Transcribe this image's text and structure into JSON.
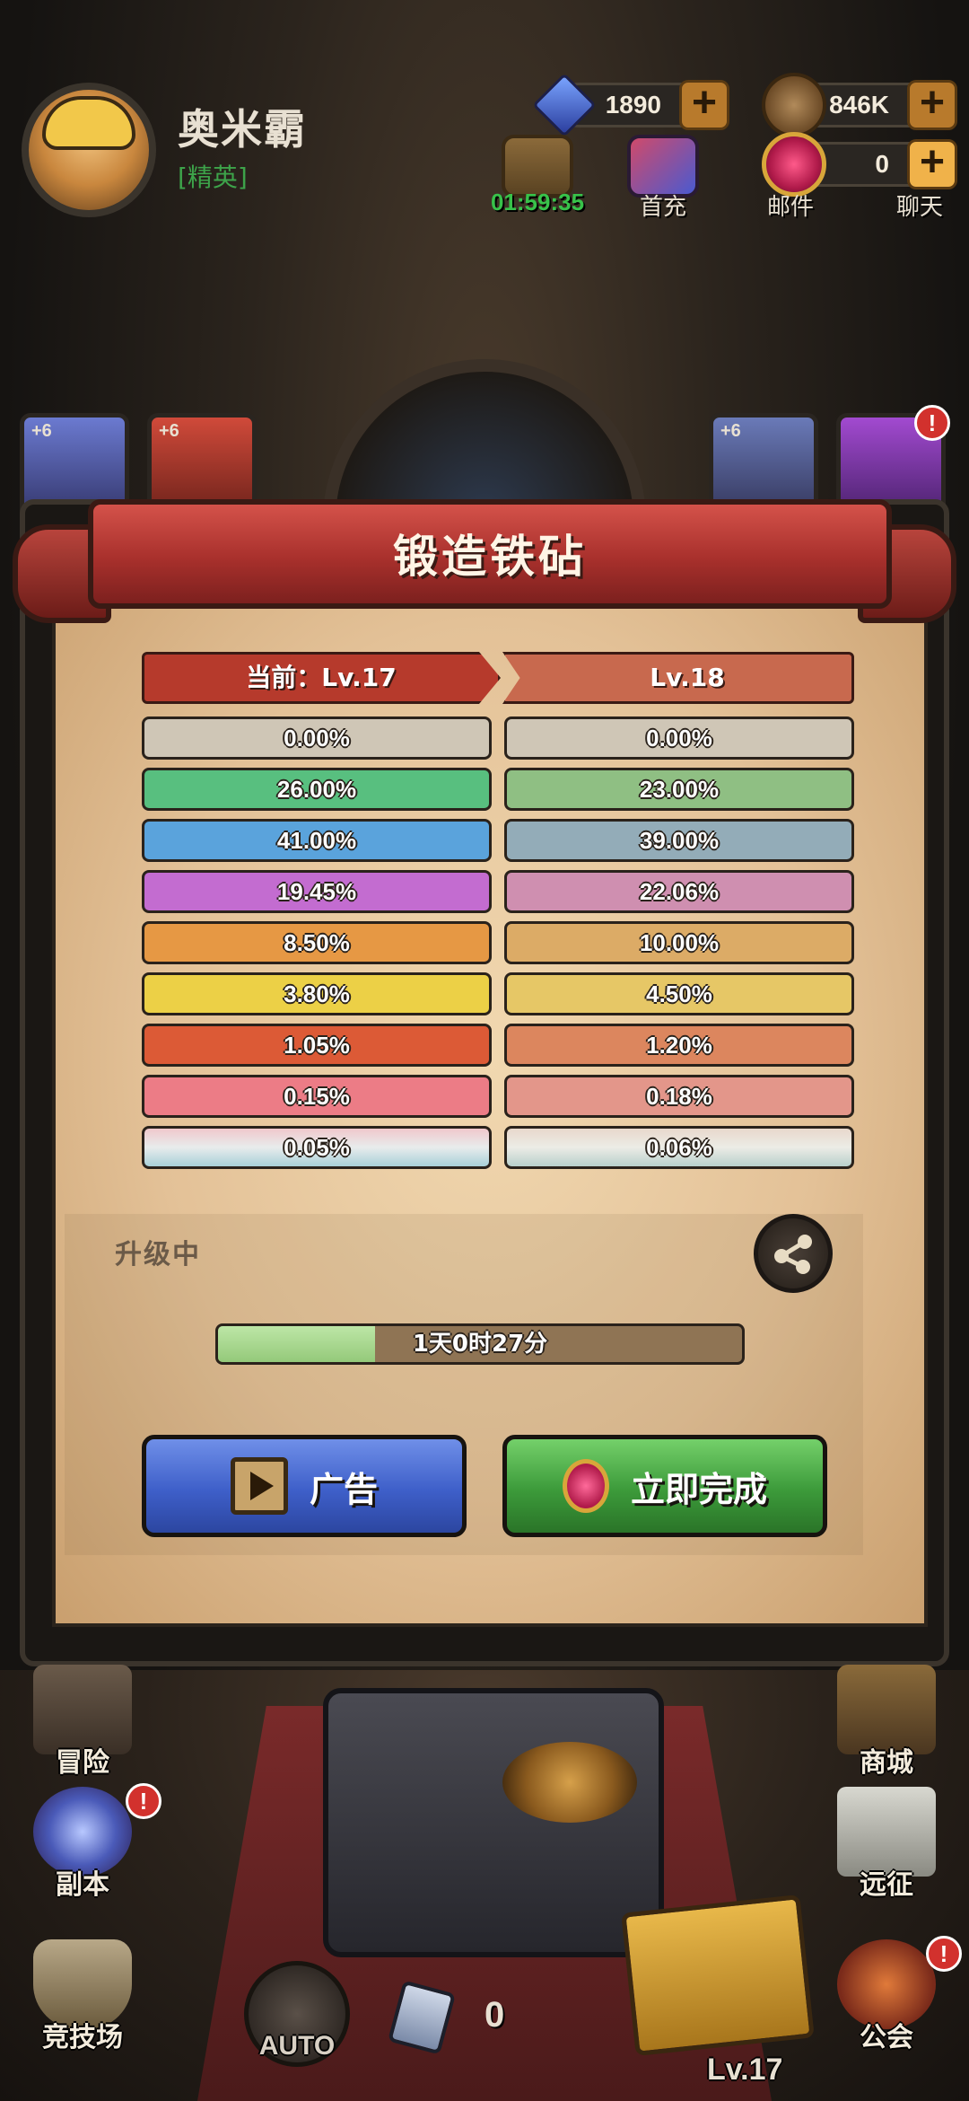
{
  "hud": {
    "player_name": "奥米霸",
    "player_rank": "[精英]",
    "gems": "1890",
    "coins": "846K",
    "pendants": "0",
    "chest_timer": "01:59:35",
    "first_recharge_label": "首充",
    "mail_label": "邮件",
    "chat_label": "聊天"
  },
  "cards": {
    "card1_plus": "+6",
    "card2_plus": "+6",
    "card3_plus": "+6",
    "badge": "!"
  },
  "dialog": {
    "title": "锻造铁砧",
    "current_level": "当前：Lv.17",
    "next_level": "Lv.18",
    "rates": [
      {
        "current": "0.00%",
        "next": "0.00%",
        "color": "#cfc6b6",
        "next_color": "#cfc6b6"
      },
      {
        "current": "26.00%",
        "next": "23.00%",
        "color": "#58bf7f",
        "next_color": "#8fbf83"
      },
      {
        "current": "41.00%",
        "next": "39.00%",
        "color": "#5aa3dc",
        "next_color": "#93acb8"
      },
      {
        "current": "19.45%",
        "next": "22.06%",
        "color": "#c36cd0",
        "next_color": "#cf8fb0"
      },
      {
        "current": "8.50%",
        "next": "10.00%",
        "color": "#e69844",
        "next_color": "#dcab66"
      },
      {
        "current": "3.80%",
        "next": "4.50%",
        "color": "#ecd046",
        "next_color": "#e6c766"
      },
      {
        "current": "1.05%",
        "next": "1.20%",
        "color": "#dc5a36",
        "next_color": "#dc865e"
      },
      {
        "current": "0.15%",
        "next": "0.18%",
        "color": "#ec7c86",
        "next_color": "#e3968a"
      },
      {
        "current": "0.05%",
        "next": "0.06%",
        "color": "#d6dce0",
        "next_color": "#d6dcd6"
      }
    ],
    "status_label": "升级中",
    "progress_text": "1天0时27分",
    "progress_fraction": 0.3,
    "ad_button": "广告",
    "finish_button": "立即完成"
  },
  "bottom_nav": {
    "adventure": "冒险",
    "shop": "商城",
    "dungeon": "副本",
    "expedition": "远征",
    "arena": "竞技场",
    "guild": "公会",
    "auto": "AUTO",
    "scroll_count": "0",
    "anvil_level": "Lv.17",
    "badge": "!"
  }
}
